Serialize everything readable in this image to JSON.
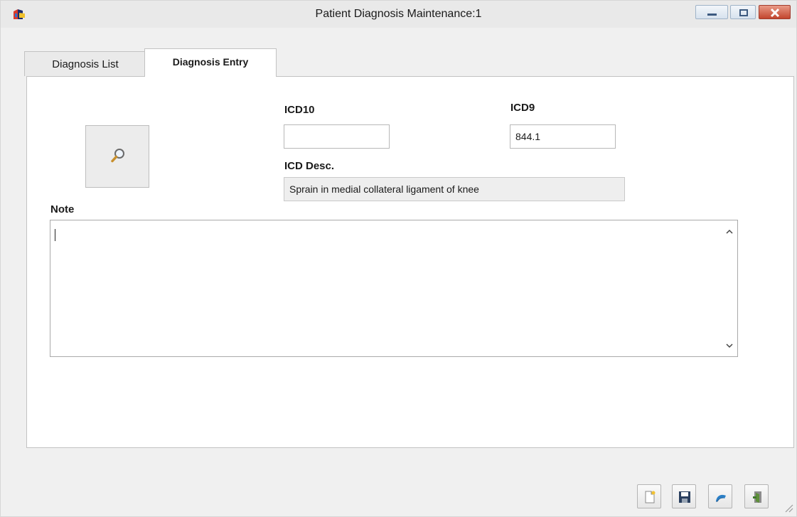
{
  "window": {
    "title": "Patient Diagnosis Maintenance:1",
    "controls": [
      "minimize-icon",
      "maximize-icon",
      "close-icon"
    ]
  },
  "tabs": [
    {
      "label": "Diagnosis List",
      "selected": false
    },
    {
      "label": "Diagnosis Entry",
      "selected": true
    }
  ],
  "form": {
    "search_button_icon": "magnifier-icon",
    "icd10": {
      "label": "ICD10",
      "value": ""
    },
    "icd9": {
      "label": "ICD9",
      "value": "844.1"
    },
    "icd_desc": {
      "label": "ICD Desc.",
      "value": "Sprain in medial collateral ligament of knee"
    },
    "note": {
      "label": "Note",
      "value": ""
    }
  },
  "toolbar": {
    "buttons": [
      "new-document-icon",
      "save-icon",
      "undo-icon",
      "exit-icon"
    ]
  },
  "colors": {
    "window_bg": "#f0f0f0",
    "panel_bg": "#ffffff",
    "readonly_bg": "#eeeeee",
    "close_red": "#c2452e"
  }
}
